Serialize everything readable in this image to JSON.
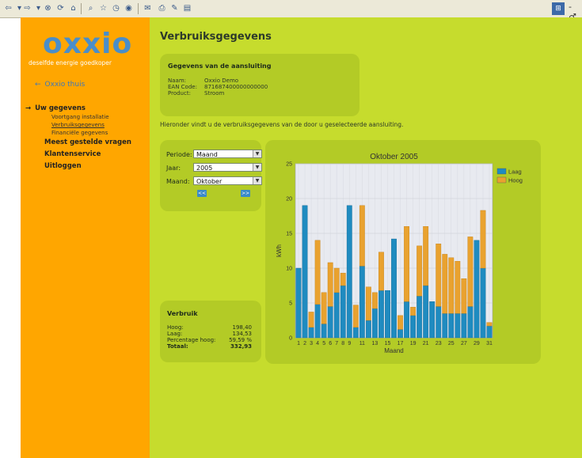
{
  "browser": {
    "toolbar_icons": [
      "back-icon",
      "forward-icon",
      "stop-icon",
      "refresh-icon",
      "home-icon",
      "search-icon",
      "favorites-icon",
      "history-icon",
      "mail-icon",
      "print-icon",
      "edit-icon",
      "discuss-icon",
      "messenger-icon"
    ],
    "window_controls": [
      "windows-logo-icon",
      "minimize-icon"
    ]
  },
  "sidebar": {
    "logo": "oxxio",
    "tagline": "deselfde energie goedkoper",
    "home_link": "Oxxio thuis",
    "section": "Uw gegevens",
    "sub_items": [
      "Voortgang installatie",
      "Verbruiksgegevens",
      "Financiële gegevens"
    ],
    "active_sub": "Verbruiksgegevens",
    "top_items": [
      "Meest gestelde vragen",
      "Klantenservice",
      "Uitloggen"
    ]
  },
  "main": {
    "title": "Verbruiksgegevens",
    "connection": {
      "heading": "Gegevens van de aansluiting",
      "labels": [
        "Naam:",
        "EAN Code:",
        "Product:"
      ],
      "values": [
        "Oxxio Demo",
        "871687400000000000",
        "Stroom"
      ]
    },
    "intro": "Hieronder vindt u de verbruiksgegevens van de door u geselecteerde aansluiting.",
    "filters": {
      "period_label": "Periode:",
      "period_value": "Maand",
      "year_label": "Jaar:",
      "year_value": "2005",
      "month_label": "Maand:",
      "month_value": "Oktober",
      "prev_label": "<<",
      "next_label": ">>"
    },
    "usage": {
      "heading": "Verbruik",
      "rows": [
        {
          "label": "Hoog:",
          "value": "198,40"
        },
        {
          "label": "Laag:",
          "value": "134,53"
        },
        {
          "label": "Percentage hoog:",
          "value": "59,59 %"
        },
        {
          "label": "Totaal:",
          "value": "332,93"
        }
      ]
    }
  },
  "colors": {
    "sidebar": "#ffa600",
    "main": "#c6dc2d",
    "panel": "#b3cb26",
    "laag": "#1f8bc0",
    "hoog": "#e9a22f"
  },
  "chart_data": {
    "type": "bar",
    "stacked": true,
    "title": "Oktober 2005",
    "xlabel": "Maand",
    "ylabel": "kWh",
    "ylim": [
      0,
      25
    ],
    "yticks": [
      0,
      5,
      10,
      15,
      20,
      25
    ],
    "grid": true,
    "legend_position": "top-right",
    "categories": [
      "1",
      "2",
      "3",
      "4",
      "5",
      "6",
      "7",
      "8",
      "9",
      "10",
      "11",
      "12",
      "13",
      "14",
      "15",
      "16",
      "17",
      "18",
      "19",
      "20",
      "21",
      "22",
      "23",
      "24",
      "25",
      "26",
      "27",
      "28",
      "29",
      "30",
      "31"
    ],
    "x_tick_labels": [
      "1",
      "2",
      "3",
      "4",
      "5",
      "6",
      "7",
      "8",
      "9",
      "11",
      "13",
      "15",
      "17",
      "19",
      "21",
      "23",
      "25",
      "27",
      "29",
      "31"
    ],
    "series": [
      {
        "name": "Laag",
        "color": "#1f8bc0",
        "values": [
          10,
          19,
          1.5,
          4.8,
          2,
          4.5,
          6.5,
          7.5,
          19,
          1.5,
          10.3,
          2.5,
          4.2,
          6.8,
          6.8,
          14.2,
          1.2,
          5.2,
          3.2,
          6,
          7.5,
          5.2,
          4.5,
          3.5,
          3.5,
          3.5,
          3.5,
          4.5,
          14,
          10,
          1.7
        ]
      },
      {
        "name": "Hoog",
        "color": "#e9a22f",
        "values": [
          0,
          0,
          2.2,
          9.2,
          4.5,
          6.3,
          3.5,
          1.8,
          0,
          3.2,
          8.7,
          4.8,
          2.3,
          5.5,
          0,
          0,
          2,
          10.8,
          1.2,
          7.2,
          8.5,
          0,
          9,
          8.5,
          8,
          7.5,
          5,
          10,
          0,
          8.3,
          0.5
        ]
      }
    ]
  }
}
